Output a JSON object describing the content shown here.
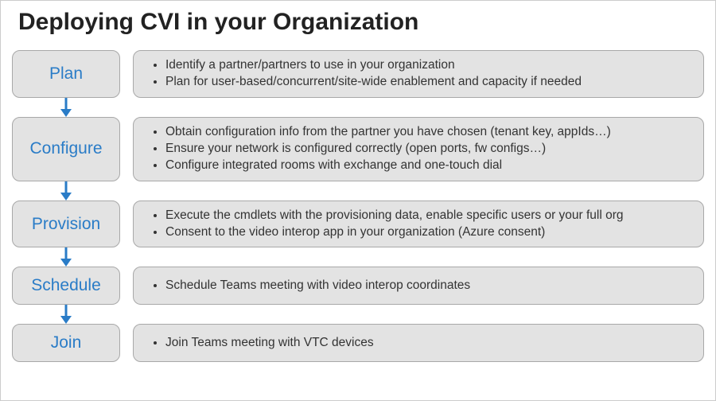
{
  "title": "Deploying CVI in your Organization",
  "steps": [
    {
      "label": "Plan",
      "items": [
        "Identify a partner/partners to use in your organization",
        "Plan for user-based/concurrent/site-wide enablement and capacity if needed"
      ]
    },
    {
      "label": "Configure",
      "items": [
        "Obtain configuration info from the partner you have chosen (tenant key, appIds…)",
        "Ensure your network is configured correctly (open ports, fw configs…)",
        "Configure integrated rooms with exchange and one-touch dial"
      ]
    },
    {
      "label": "Provision",
      "items": [
        "Execute the cmdlets with the provisioning data, enable specific users or your full org",
        "Consent to the video interop app in your organization (Azure consent)"
      ]
    },
    {
      "label": "Schedule",
      "items": [
        "Schedule Teams meeting with video interop coordinates"
      ]
    },
    {
      "label": "Join",
      "items": [
        "Join Teams meeting with VTC devices"
      ]
    }
  ],
  "colors": {
    "accent": "#2a7cc7",
    "box_bg": "#e3e3e3",
    "box_border": "#a8a8a8"
  }
}
